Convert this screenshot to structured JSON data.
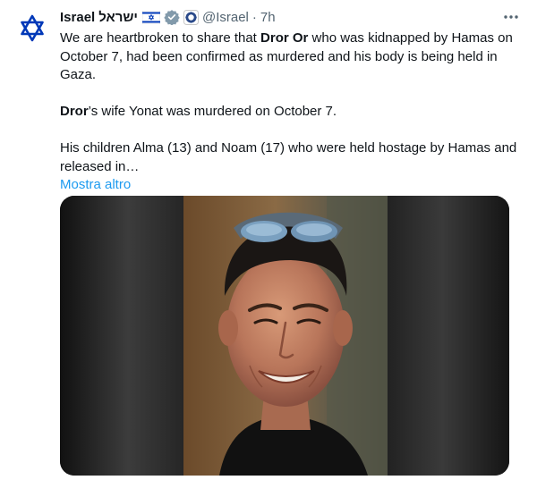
{
  "tweet": {
    "author": {
      "name": "Israel",
      "name_hebrew": "ישראל",
      "handle": "@Israel",
      "separator": "·",
      "time": "7h"
    },
    "text": {
      "p1_a": "We are heartbroken to share that ",
      "p1_b": "Dror Or",
      "p1_c": " who was kidnapped by Hamas on October 7, had been confirmed as murdered and his body is being held in Gaza.",
      "p2_a": "Dror",
      "p2_b": "’s wife Yonat was murdered on October 7.",
      "p3": "His children Alma (13) and Noam (17) who were held hostage by Hamas and released in…"
    },
    "show_more_label": "Mostra altro",
    "icons": {
      "avatar": "star-of-david-icon",
      "flag": "israel-flag-icon",
      "verified": "gray-verified-badge-icon",
      "affiliate": "state-emblem-icon",
      "more": "more-options-icon"
    },
    "colors": {
      "link": "#1d9bf0",
      "secondary_text": "#536471",
      "israel_blue": "#0038b8"
    }
  }
}
